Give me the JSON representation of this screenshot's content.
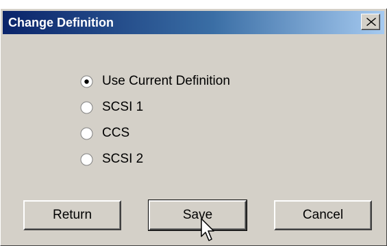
{
  "window": {
    "title": "Change Definition",
    "close_label": "X"
  },
  "options": [
    {
      "label": "Use Current Definition",
      "selected": true
    },
    {
      "label": "SCSI 1",
      "selected": false
    },
    {
      "label": "CCS",
      "selected": false
    },
    {
      "label": "SCSI 2",
      "selected": false
    }
  ],
  "buttons": {
    "return_label": "Return",
    "save_label": "Save",
    "cancel_label": "Cancel"
  },
  "colors": {
    "dialog_bg": "#d4d0c8",
    "title_start": "#0a246a",
    "title_end": "#a6caf0"
  },
  "icons": [
    "close-icon",
    "radio-selected-icon",
    "radio-unselected-icon",
    "mouse-pointer-icon"
  ]
}
